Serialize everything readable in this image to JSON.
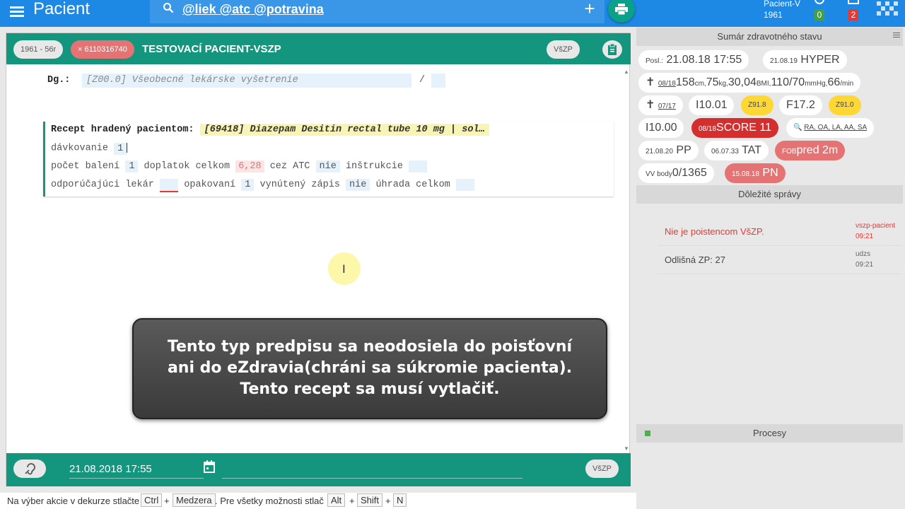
{
  "topbar": {
    "title": "Pacient",
    "search_text": "@liek @atc @potravina",
    "add_label": "+",
    "patient_label": "Pacient-V",
    "patient_year": "1961",
    "badge_green": "0",
    "badge_red": "2",
    "accent": "#1e88e5"
  },
  "editor": {
    "chip_age": "1961 - 56r",
    "chip_id_x": "×",
    "chip_id": "6110316740",
    "title": "TESTOVACÍ PACIENT-VSZP",
    "chip_insurer": "VšZP",
    "dg_label": "Dg.:",
    "dg_value": "[Z00.0] Všeobecné lekárske vyšetrenie",
    "dg_slash": "/",
    "recept_label": "Recept hradený pacientom:",
    "recept_value": "[69418] Diazepam Desitin rectal tube 10 mg | sol…",
    "dosage_label": "dávkovanie",
    "dosage_value": "1",
    "packs_label": "počet balení",
    "packs_value": "1",
    "copay_label": "doplatok celkom",
    "copay_value": "6,28",
    "via_atc_label": "cez ATC",
    "via_atc_value": "nie",
    "instructions_label": "inštrukcie",
    "doctor_label": "odporúčajúci lekár",
    "repeat_label": "opakovaní",
    "repeat_value": "1",
    "forced_label": "vynútený zápis",
    "forced_value": "nie",
    "payment_label": "úhrada celkom",
    "accent": "#13957e"
  },
  "tooltip": {
    "line1": "Tento typ predpisu sa neodosiela do poisťovní",
    "line2": "ani do eZdravia(chráni sa súkromie pacienta).",
    "line3": "Tento recept sa musí vytlačiť."
  },
  "footer": {
    "date": "21.08.2018 17:55",
    "insurer": "VšZP"
  },
  "statusbar": {
    "text1": "Na výber akcie v dekurze stlačte",
    "key_ctrl": "Ctrl",
    "plus": "+",
    "key_space": "Medzera",
    "text2": ". Pre všetky možnosti stlač",
    "key_alt": "Alt",
    "key_shift": "Shift",
    "key_n": "N"
  },
  "summary": {
    "header": "Sumár zdravotného stavu",
    "posl_small": "Posl.:",
    "posl_value": "21.08.18 17:55",
    "hyper_date": "21.08.19",
    "hyper": "HYPER",
    "cross": "✝",
    "vitals_date": "08/18",
    "h": "158",
    "h_u": "cm,",
    "w": "75",
    "w_u": "kg,",
    "bmi": "30,04",
    "bmi_u": "BMI,",
    "bp": "110/70",
    "bp_u": "mmHg,",
    "pulse": "66",
    "pulse_u": "/min",
    "cross2_date": "07/17",
    "i1001": "I10.01",
    "z918": "Z91.8",
    "f172": "F17.2",
    "z910": "Z91.0",
    "i1000": "I10.00",
    "score_date": "08/18",
    "score": "SCORE 11",
    "ra": "RA, OA, LA, AA, SA",
    "pp_date": "21.08.20",
    "pp": "PP",
    "tat_date": "06.07.33",
    "tat": "TAT",
    "fob": "FOB",
    "fob_val": "pred 2m",
    "vv": "VV body",
    "vv_val": "0/1365",
    "pn_date": "15.08.18",
    "pn": "PN"
  },
  "messages": {
    "header": "Dôležité správy",
    "items": [
      {
        "text": "Nie je poistencom VšZP.",
        "source": "vszp-pacient",
        "time": "09:21"
      },
      {
        "text": "Odlišná ZP: 27",
        "source": "udzs",
        "time": "09:21"
      }
    ]
  },
  "processes": {
    "header": "Procesy"
  }
}
